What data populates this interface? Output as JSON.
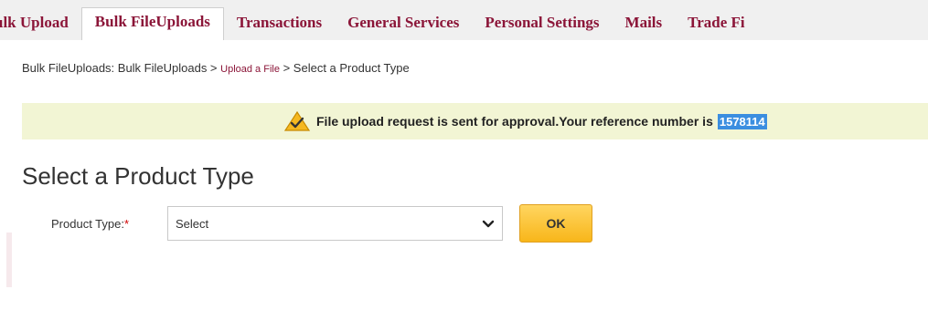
{
  "tabs": [
    {
      "label": "ulk Upload",
      "active": false
    },
    {
      "label": "Bulk FileUploads",
      "active": true
    },
    {
      "label": "Transactions",
      "active": false
    },
    {
      "label": "General Services",
      "active": false
    },
    {
      "label": "Personal Settings",
      "active": false
    },
    {
      "label": "Mails",
      "active": false
    },
    {
      "label": "Trade Fi",
      "active": false
    }
  ],
  "breadcrumb": {
    "prefix": "Bulk FileUploads: Bulk FileUploads",
    "sep1": " > ",
    "link": "Upload a File",
    "sep2": " > ",
    "current": "Select a Product Type"
  },
  "notice": {
    "text": "File upload request is sent for approval.Your reference number is",
    "reference": "1578114",
    "icon": "warning-check-icon"
  },
  "page_title": "Select a Product Type",
  "form": {
    "product_type_label": "Product Type:",
    "required_mark": "*",
    "product_type_value": "Select",
    "ok_label": "OK"
  },
  "colors": {
    "tab_text": "#8b1538",
    "notice_bg": "#f2f5d4",
    "reference_highlight": "#3b8ee0",
    "ok_button": "#f8b61a"
  }
}
